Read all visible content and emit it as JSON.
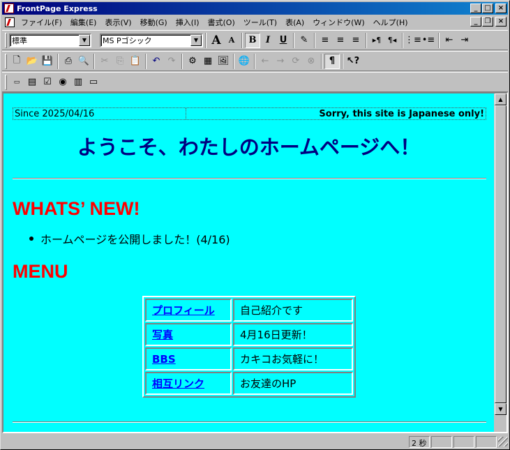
{
  "window": {
    "title": "FrontPage Express"
  },
  "menu": [
    "ファイル(F)",
    "編集(E)",
    "表示(V)",
    "移動(G)",
    "挿入(I)",
    "書式(O)",
    "ツール(T)",
    "表(A)",
    "ウィンドウ(W)",
    "ヘルプ(H)"
  ],
  "format_toolbar": {
    "style_value": "標準",
    "font_value": "MS Pゴシック"
  },
  "page": {
    "since": "Since 2025/04/16",
    "notice": "Sorry, this site is Japanese only!",
    "welcome": "ようこそ、わたしのホームページへ！",
    "whats_new_heading": "WHATS’ NEW!",
    "news_items": [
      "ホームページを公開しました！(4/16)"
    ],
    "menu_heading": "MENU",
    "menu_table": [
      {
        "link": "プロフィール",
        "desc": "自己紹介です"
      },
      {
        "link": "写真",
        "desc": "4月16日更新！"
      },
      {
        "link": "BBS",
        "desc": "カキコお気軽に！"
      },
      {
        "link": "相互リンク",
        "desc": "お友達のHP"
      }
    ]
  },
  "statusbar": {
    "time": "2 秒"
  },
  "colors": {
    "page_bg": "#00ffff",
    "heading_red": "#ff0000",
    "welcome_navy": "#000080",
    "link_blue": "#0000ff"
  }
}
